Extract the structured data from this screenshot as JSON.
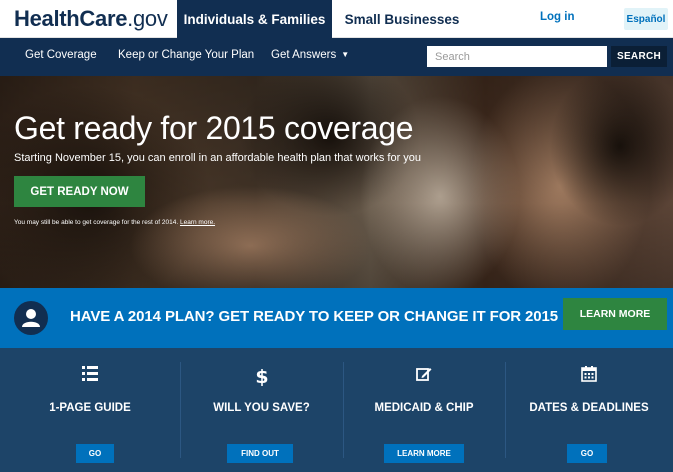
{
  "header": {
    "logo_health_care": "HealthCare",
    "logo_gov": ".gov",
    "tab_individuals": "Individuals & Families",
    "tab_small_business": "Small Businesses",
    "login": "Log in",
    "espanol": "Español"
  },
  "nav": {
    "get_coverage": "Get Coverage",
    "keep_or_change": "Keep or Change Your Plan",
    "get_answers": "Get Answers",
    "search_placeholder": "Search",
    "search_button": "SEARCH"
  },
  "hero": {
    "title": "Get ready for 2015 coverage",
    "subtitle": "Starting November 15, you can enroll in an affordable health plan that works for you",
    "cta": "GET READY NOW",
    "note": "You may still be able to get coverage for the rest of 2014.",
    "note_link": "Learn more."
  },
  "banner": {
    "text": "HAVE A 2014 PLAN? GET READY TO KEEP OR CHANGE IT FOR 2015",
    "button": "LEARN MORE"
  },
  "tiles": [
    {
      "label": "1-PAGE GUIDE",
      "button": "GO",
      "icon": "list-icon"
    },
    {
      "label": "WILL YOU SAVE?",
      "button": "FIND OUT",
      "icon": "dollar-icon"
    },
    {
      "label": "MEDICAID & CHIP",
      "button": "LEARN MORE",
      "icon": "edit-icon"
    },
    {
      "label": "DATES & DEADLINES",
      "button": "GO",
      "icon": "calendar-icon"
    }
  ],
  "colors": {
    "navy": "#112e51",
    "blue": "#0071bc",
    "green": "#2e8540",
    "tile_bg": "#1d4468"
  }
}
